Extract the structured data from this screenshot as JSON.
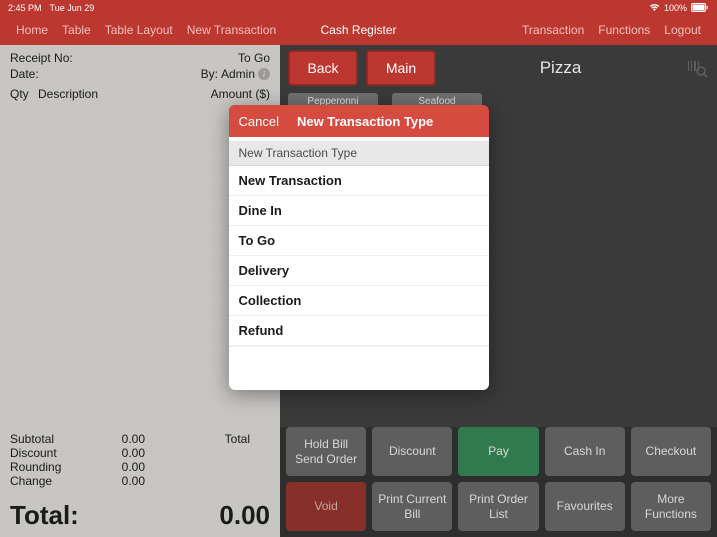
{
  "status": {
    "time": "2:45 PM",
    "date": "Tue Jun 29",
    "battery": "100%",
    "wifi": "wifi"
  },
  "nav": {
    "left": [
      "Home",
      "Table",
      "Table Layout",
      "New Transaction"
    ],
    "center": "Cash Register",
    "right": [
      "Transaction",
      "Functions",
      "Logout"
    ]
  },
  "receipt": {
    "receipt_no_label": "Receipt No:",
    "receipt_no_value": "",
    "togo": "To Go",
    "date_label": "Date:",
    "date_value": "",
    "by_label": "By:",
    "by_value": "Admin",
    "qty_header": "Qty",
    "desc_header": "Description",
    "amount_header": "Amount ($)",
    "subtotal": {
      "label": "Subtotal",
      "value": "0.00"
    },
    "discount": {
      "label": "Discount",
      "value": "0.00"
    },
    "rounding": {
      "label": "Rounding",
      "value": "0.00"
    },
    "change": {
      "label": "Change",
      "value": "0.00"
    },
    "total_label_small": "Total",
    "grand_total_label": "Total:",
    "grand_total_value": "0.00"
  },
  "top": {
    "back": "Back",
    "main": "Main",
    "category": "Pizza",
    "tags": [
      "Pepperonni",
      "Seafood"
    ]
  },
  "bottom": [
    {
      "label": "Hold Bill\nSend Order",
      "style": "gray"
    },
    {
      "label": "Discount",
      "style": "gray"
    },
    {
      "label": "Pay",
      "style": "green"
    },
    {
      "label": "Cash In",
      "style": "gray"
    },
    {
      "label": "Checkout",
      "style": "gray"
    },
    {
      "label": "Void",
      "style": "darkred"
    },
    {
      "label": "Print Current Bill",
      "style": "gray"
    },
    {
      "label": "Print Order List",
      "style": "gray"
    },
    {
      "label": "Favourites",
      "style": "gray"
    },
    {
      "label": "More Functions",
      "style": "gray"
    }
  ],
  "modal": {
    "cancel": "Cancel",
    "title": "New Transaction Type",
    "section_header": "New Transaction Type",
    "items": [
      "New Transaction",
      "Dine In",
      "To Go",
      "Delivery",
      "Collection",
      "Refund"
    ]
  }
}
